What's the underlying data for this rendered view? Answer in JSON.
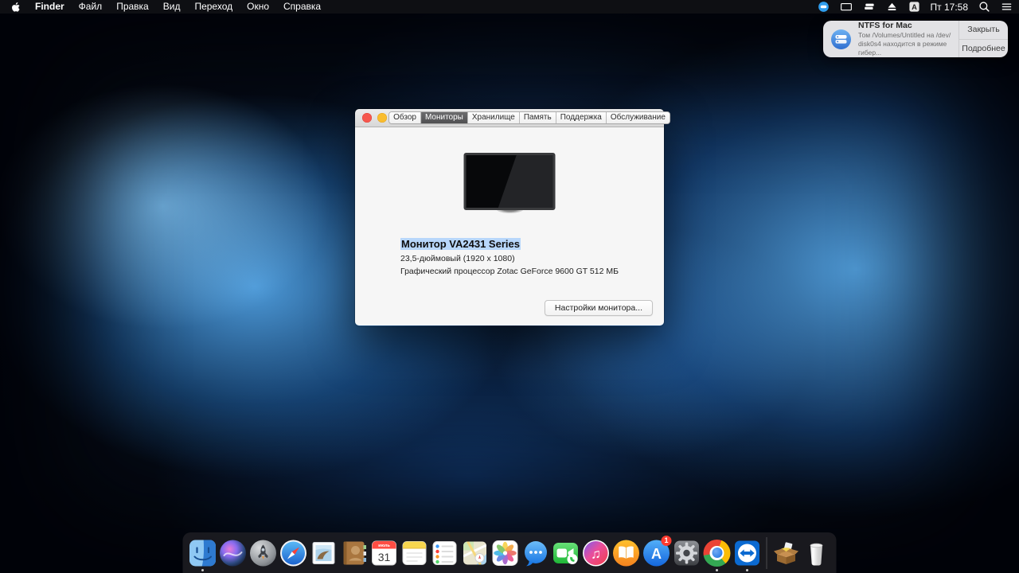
{
  "menu_bar": {
    "app_name": "Finder",
    "menus": [
      "Файл",
      "Правка",
      "Вид",
      "Переход",
      "Окно",
      "Справка"
    ],
    "input_source_letter": "A",
    "clock": "Пт 17:58",
    "status_icons": [
      "teamviewer",
      "display",
      "disk-stack",
      "eject",
      "input-source",
      "spotlight",
      "notification-center"
    ]
  },
  "notification": {
    "app_title": "NTFS for Mac",
    "body_line1": "Том /Volumes/Untitled на /dev/",
    "body_line2": "disk0s4 находится в режиме гибер...",
    "close_button": "Закрыть",
    "more_button": "Подробнее"
  },
  "about_window": {
    "tabs": [
      "Обзор",
      "Мониторы",
      "Хранилище",
      "Память",
      "Поддержка",
      "Обслуживание"
    ],
    "selected_tab": "Мониторы",
    "display_name": "Монитор VA2431 Series",
    "display_size": "23,5-дюймовый (1920 x 1080)",
    "display_gpu": "Графический процессор Zotac GeForce 9600 GT 512 МБ",
    "settings_button": "Настройки монитора..."
  },
  "dock": {
    "items": [
      "finder",
      "siri",
      "launchpad",
      "safari",
      "mail",
      "contacts",
      "calendar",
      "notes",
      "reminders",
      "maps",
      "photos",
      "messages",
      "facetime",
      "itunes",
      "ibooks",
      "app-store",
      "system-preferences",
      "chrome",
      "teamviewer",
      "package",
      "trash"
    ],
    "running_apps": [
      "finder",
      "chrome",
      "teamviewer"
    ],
    "calendar_month": "июль",
    "calendar_day": "31",
    "app_store_letter": "A",
    "app_store_badge": "1",
    "itunes_glyph": "♫"
  },
  "colors": {
    "selection_highlight": "#b8d7fb",
    "menu_bar_bg": "#0f1014",
    "dock_bg": "rgba(30,31,35,0.82)",
    "accent_blue": "#1a6fe0"
  }
}
